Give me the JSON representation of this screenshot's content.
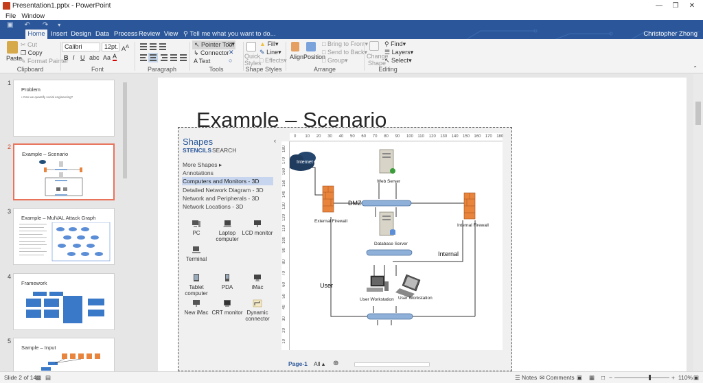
{
  "window": {
    "title": "Presentation1.pptx - PowerPoint"
  },
  "menubar": {
    "items": [
      "File",
      "Window"
    ]
  },
  "tabs": [
    "Home",
    "Insert",
    "Design",
    "Data",
    "Process",
    "Review",
    "View"
  ],
  "tell_me": "Tell me what you want to do...",
  "user": "Christopher Zhong",
  "ribbon": {
    "clipboard": {
      "paste": "Paste",
      "cut": "Cut",
      "copy": "Copy",
      "format_painter": "Format Painter",
      "label": "Clipboard"
    },
    "font": {
      "name": "Calibri",
      "size": "12pt.",
      "label": "Font"
    },
    "paragraph": {
      "label": "Paragraph"
    },
    "tools": {
      "pointer": "Pointer Tool",
      "connector": "Connector",
      "text": "Text",
      "label": "Tools"
    },
    "shape_styles": {
      "quick": "Quick",
      "styles": "Styles",
      "fill": "Fill",
      "line": "Line",
      "effects": "Effects",
      "label": "Shape Styles"
    },
    "arrange": {
      "align": "Align",
      "position": "Position",
      "bring_front": "Bring to Front",
      "send_back": "Send to Back",
      "group": "Group",
      "label": "Arrange"
    },
    "editing": {
      "change": "Change",
      "shape": "Shape",
      "find": "Find",
      "layers": "Layers",
      "select": "Select",
      "label": "Editing"
    }
  },
  "slides": [
    {
      "num": "1",
      "title": "Problem",
      "body": "• Can we quantify social engineering?"
    },
    {
      "num": "2",
      "title": "Example – Scenario",
      "body": ""
    },
    {
      "num": "3",
      "title": "Example – MulVAL Attack Graph",
      "body": ""
    },
    {
      "num": "4",
      "title": "Framework",
      "body": ""
    },
    {
      "num": "5",
      "title": "Sample – Input",
      "body": ""
    }
  ],
  "current_slide": {
    "title": "Example – Scenario"
  },
  "visio": {
    "shapes_title": "Shapes",
    "tabs": {
      "stencils": "STENCILS",
      "search": "SEARCH"
    },
    "more_shapes": "More Shapes",
    "stencils": [
      "Annotations",
      "Computers and Monitors - 3D",
      "Detailed Network Diagram - 3D",
      "Network and Peripherals - 3D",
      "Network Locations - 3D"
    ],
    "shape_items": [
      {
        "label": "PC",
        "icon": "pc-icon"
      },
      {
        "label": "Laptop computer",
        "icon": "laptop-icon"
      },
      {
        "label": "LCD monitor",
        "icon": "lcd-monitor-icon"
      },
      {
        "label": "Terminal",
        "icon": "terminal-icon"
      },
      {
        "label": "Tablet computer",
        "icon": "tablet-icon"
      },
      {
        "label": "PDA",
        "icon": "pda-icon"
      },
      {
        "label": "iMac",
        "icon": "imac-icon"
      },
      {
        "label": "New iMac",
        "icon": "new-imac-icon"
      },
      {
        "label": "CRT monitor",
        "icon": "crt-monitor-icon"
      },
      {
        "label": "Dynamic connector",
        "icon": "dynamic-connector-icon"
      }
    ],
    "ruler_top": [
      "0",
      "10",
      "20",
      "30",
      "40",
      "50",
      "60",
      "70",
      "80",
      "90",
      "100",
      "110",
      "120",
      "130",
      "140",
      "150",
      "160",
      "170",
      "180"
    ],
    "ruler_left": [
      "180",
      "170",
      "160",
      "150",
      "140",
      "130",
      "120",
      "110",
      "100",
      "90",
      "80",
      "70",
      "60",
      "50",
      "40",
      "30",
      "20",
      "10"
    ],
    "diagram": {
      "internet": "Internet",
      "web_server": "Web Server",
      "dmz": "DMZ",
      "external_firewall": "External Firewall",
      "internal_firewall": "Internal Firewall",
      "database_server": "Database Server",
      "internal": "Internal",
      "user": "User",
      "user_workstation_1": "User Workstation",
      "user_workstation_2": "User Workstation"
    },
    "page_tab": "Page-1",
    "all_tab": "All"
  },
  "status": {
    "slide": "Slide 2 of 14",
    "notes": "Notes",
    "comments": "Comments",
    "zoom": "110%"
  }
}
